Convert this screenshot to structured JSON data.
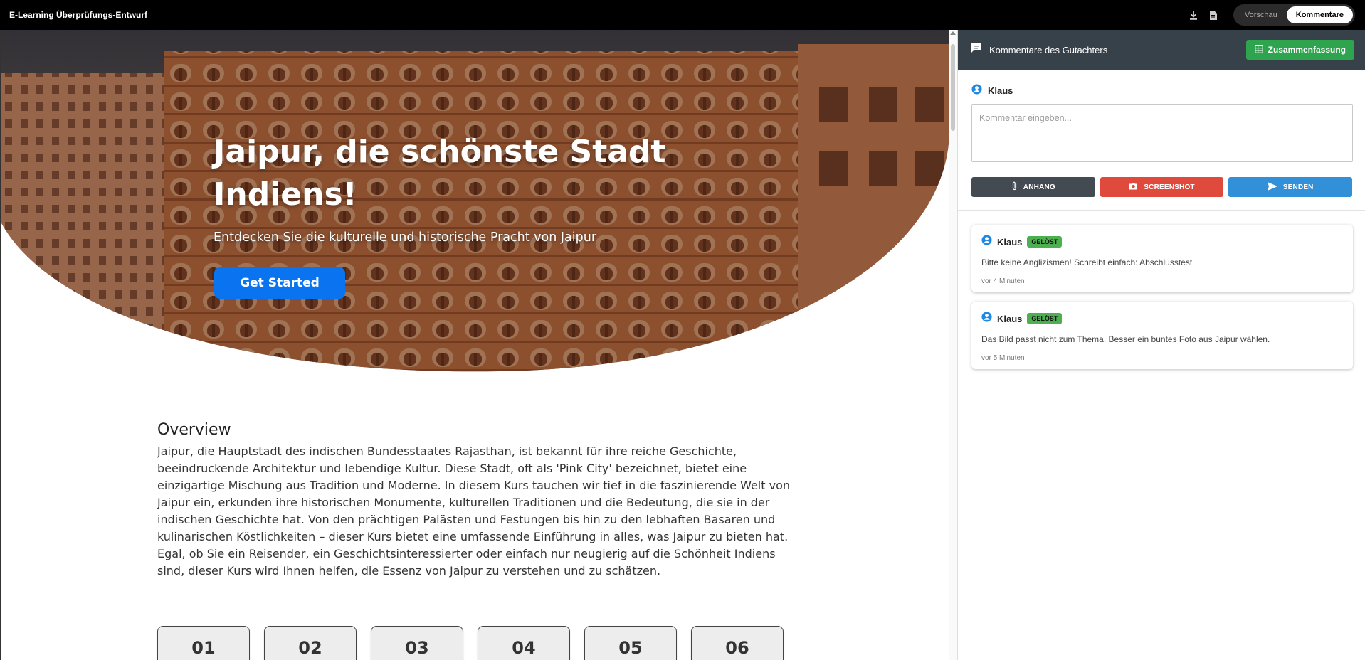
{
  "app": {
    "title": "E-Learning Überprüfungs-Entwurf"
  },
  "topbar": {
    "download_icon": "download-icon",
    "document_icon": "document-icon",
    "views": [
      {
        "label": "Vorschau",
        "active": false
      },
      {
        "label": "Kommentare",
        "active": true
      }
    ]
  },
  "hero": {
    "title": "Jaipur, die schönste Stadt Indiens!",
    "subtitle": "Entdecken Sie die kulturelle und historische Pracht von Jaipur",
    "button": "Get Started"
  },
  "overview": {
    "heading": "Overview",
    "text": "Jaipur, die Hauptstadt des indischen Bundesstaates Rajasthan, ist bekannt für ihre reiche Geschichte, beeindruckende Architektur und lebendige Kultur. Diese Stadt, oft als 'Pink City' bezeichnet, bietet eine einzigartige Mischung aus Tradition und Moderne. In diesem Kurs tauchen wir tief in die faszinierende Welt von Jaipur ein, erkunden ihre historischen Monumente, kulturellen Traditionen und die Bedeutung, die sie in der indischen Geschichte hat. Von den prächtigen Palästen und Festungen bis hin zu den lebhaften Basaren und kulinarischen Köstlichkeiten – dieser Kurs bietet eine umfassende Einführung in alles, was Jaipur zu bieten hat. Egal, ob Sie ein Reisender, ein Geschichtsinteressierter oder einfach nur neugierig auf die Schönheit Indiens sind, dieser Kurs wird Ihnen helfen, die Essenz von Jaipur zu verstehen und zu schätzen."
  },
  "steps": [
    "01",
    "02",
    "03",
    "04",
    "05",
    "06"
  ],
  "panel": {
    "title": "Kommentare des Gutachters",
    "summary_button": "Zusammenfassung",
    "user": "Klaus",
    "input_placeholder": "Kommentar eingeben...",
    "buttons": {
      "attach": "ANHANG",
      "screenshot": "SCREENSHOT",
      "send": "SENDEN"
    },
    "comments": [
      {
        "author": "Klaus",
        "status": "GELÖST",
        "text": "Bitte keine Anglizismen! Schreibt einfach: Abschlusstest",
        "time": "vor 4 Minuten"
      },
      {
        "author": "Klaus",
        "status": "GELÖST",
        "text": "Das Bild passt nicht zum Thema. Besser ein buntes Foto aus Jaipur wählen.",
        "time": "vor 5 Minuten"
      }
    ]
  },
  "colors": {
    "accent_blue": "#0a73f0",
    "header_dark": "#37414a",
    "success": "#2ea44f",
    "danger": "#e04a3c",
    "send": "#3190d8"
  }
}
